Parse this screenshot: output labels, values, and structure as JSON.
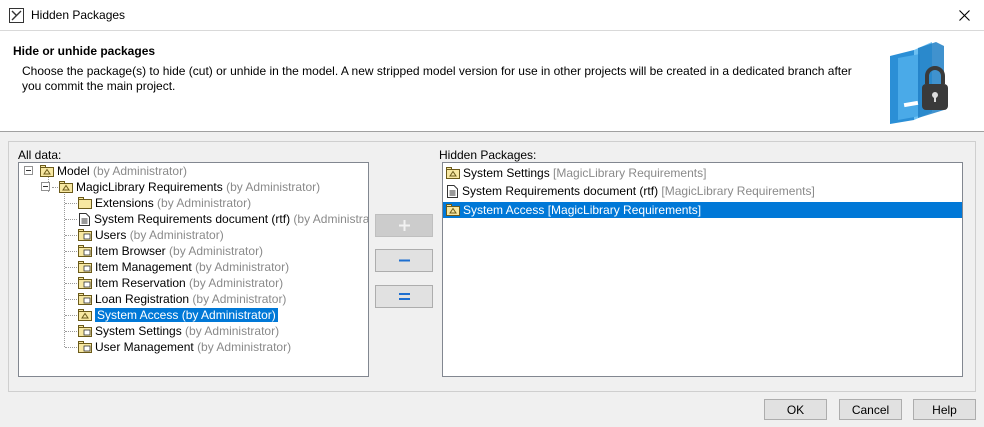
{
  "window": {
    "title": "Hidden Packages",
    "close_icon": "close-icon"
  },
  "header": {
    "title": "Hide or unhide packages",
    "description": "Choose the package(s) to hide (cut) or unhide in the model. A new stripped model version for use in other projects will be created in a dedicated branch after you commit the main project."
  },
  "all_data": {
    "label": "All data:",
    "tree": [
      {
        "name": "Model",
        "owner": "(by Administrator)",
        "level": 0,
        "icon": "package-icon"
      },
      {
        "name": "MagicLibrary Requirements",
        "owner": "(by Administrator)",
        "level": 1,
        "icon": "package-icon"
      },
      {
        "name": "Extensions",
        "owner": "(by Administrator)",
        "level": 2,
        "icon": "folder-icon"
      },
      {
        "name": "System Requirements document (rtf)",
        "owner": "(by Administrator)",
        "level": 2,
        "icon": "document-icon"
      },
      {
        "name": "Users",
        "owner": "(by Administrator)",
        "level": 2,
        "icon": "requirement-package-icon"
      },
      {
        "name": "Item Browser",
        "owner": "(by Administrator)",
        "level": 2,
        "icon": "requirement-package-icon"
      },
      {
        "name": "Item Management",
        "owner": "(by Administrator)",
        "level": 2,
        "icon": "requirement-package-icon"
      },
      {
        "name": "Item Reservation",
        "owner": "(by Administrator)",
        "level": 2,
        "icon": "requirement-package-icon"
      },
      {
        "name": "Loan Registration",
        "owner": "(by Administrator)",
        "level": 2,
        "icon": "requirement-package-icon"
      },
      {
        "name": "System Access",
        "owner": "(by Administrator)",
        "level": 2,
        "icon": "package-icon",
        "selected": true
      },
      {
        "name": "System Settings",
        "owner": "(by Administrator)",
        "level": 2,
        "icon": "requirement-package-icon"
      },
      {
        "name": "User Management",
        "owner": "(by Administrator)",
        "level": 2,
        "icon": "requirement-package-icon"
      }
    ]
  },
  "hidden": {
    "label": "Hidden Packages:",
    "items": [
      {
        "name": "System Settings",
        "context": "[MagicLibrary Requirements]",
        "icon": "package-icon"
      },
      {
        "name": "System Requirements document (rtf)",
        "context": "[MagicLibrary Requirements]",
        "icon": "document-icon"
      },
      {
        "name": "System Access",
        "context": "[MagicLibrary Requirements]",
        "icon": "package-icon",
        "selected": true
      }
    ]
  },
  "actions": {
    "add": "plus-icon",
    "remove": "minus-icon",
    "remove_all": "double-minus-icon"
  },
  "buttons": {
    "ok": "OK",
    "cancel": "Cancel",
    "help": "Help"
  },
  "colors": {
    "selection": "#0078d7",
    "owner_text": "#8a8a8a"
  }
}
